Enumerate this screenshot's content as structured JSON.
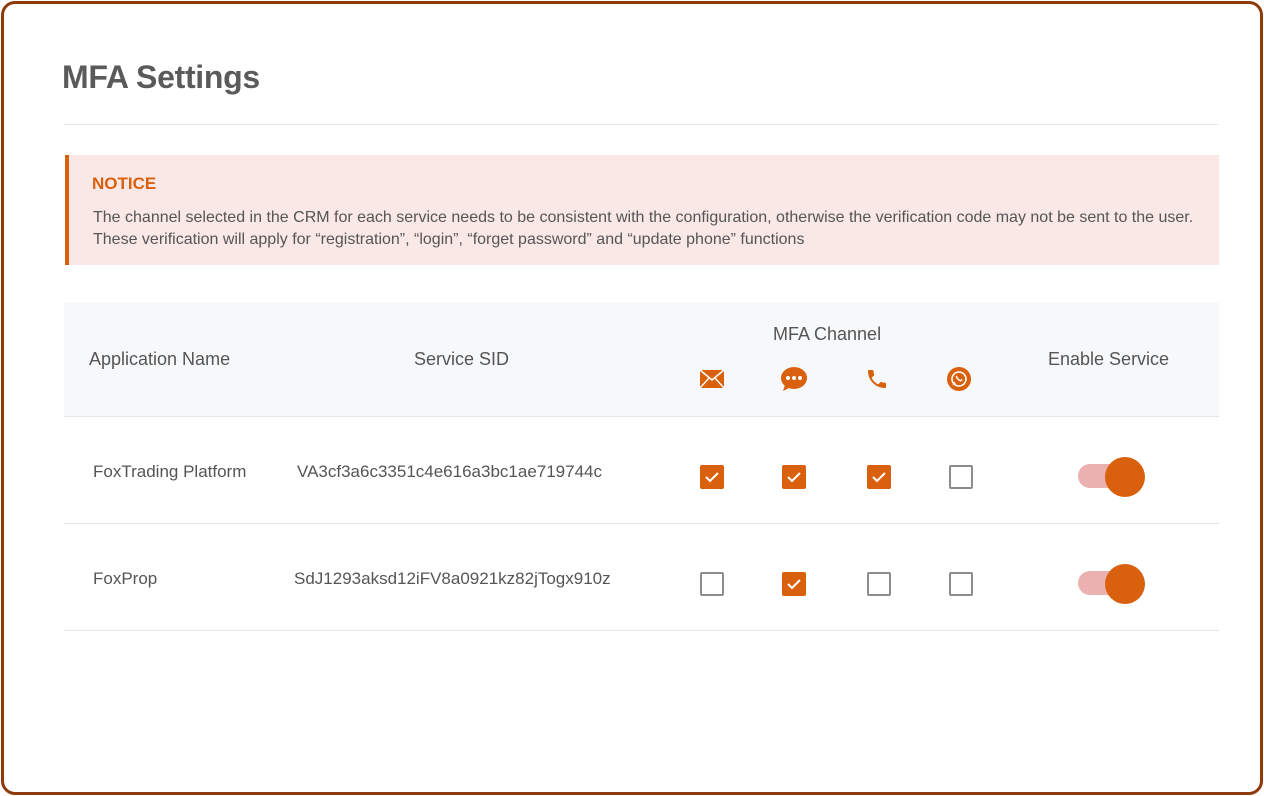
{
  "page": {
    "title": "MFA Settings"
  },
  "notice": {
    "title": "NOTICE",
    "text": "The channel selected in the CRM for each service needs to be consistent with the configuration, otherwise the verification code may not be sent to the user. These verification will apply for “registration”, “login”, “forget password” and “update phone” functions"
  },
  "table": {
    "headers": {
      "application_name": "Application Name",
      "service_sid": "Service SID",
      "mfa_channel": "MFA Channel",
      "enable_service": "Enable Service"
    },
    "channels": [
      {
        "name": "email",
        "icon": "envelope-icon"
      },
      {
        "name": "sms",
        "icon": "chat-bubble-icon"
      },
      {
        "name": "voice",
        "icon": "phone-icon"
      },
      {
        "name": "whatsapp",
        "icon": "whatsapp-icon"
      }
    ],
    "rows": [
      {
        "application_name": "FoxTrading Platform",
        "service_sid": "VA3cf3a6c3351c4e616a3bc1ae719744c",
        "channels": {
          "email": true,
          "sms": true,
          "voice": true,
          "whatsapp": false
        },
        "enabled": true
      },
      {
        "application_name": "FoxProp",
        "service_sid": "SdJ1293aksd12iFV8a0921kz82jTogx910z",
        "channels": {
          "email": false,
          "sms": true,
          "voice": false,
          "whatsapp": false
        },
        "enabled": true
      }
    ]
  },
  "colors": {
    "accent": "#d9600c",
    "frame": "#8f3a0c",
    "notice_bg": "#fae8e6",
    "toggle_track": "#ebb1b0"
  }
}
